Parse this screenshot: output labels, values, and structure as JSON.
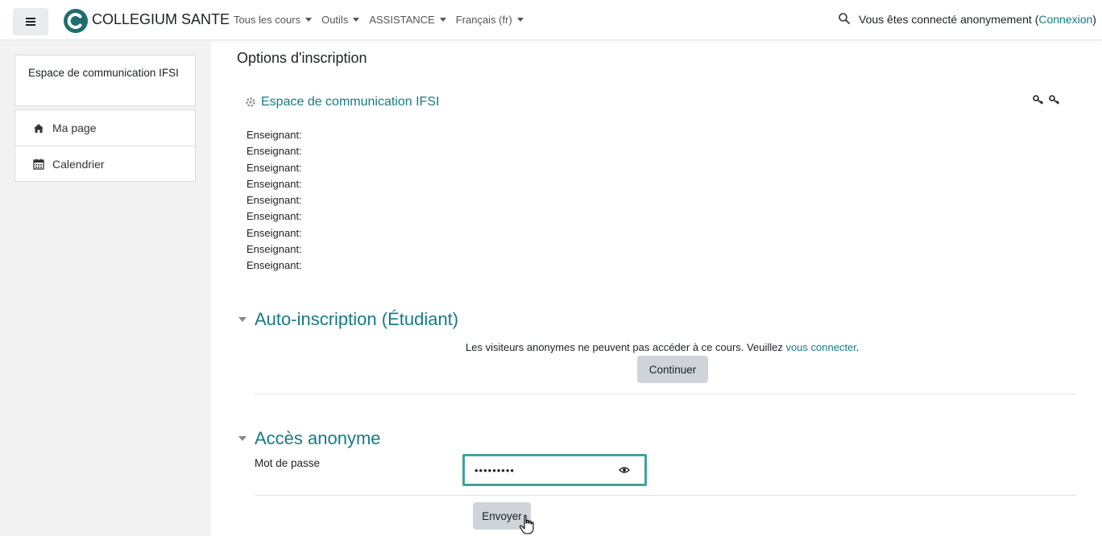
{
  "navbar": {
    "brand": "COLLEGIUM SANTE",
    "menu": [
      {
        "label": "Tous les cours"
      },
      {
        "label": "Outils"
      },
      {
        "label": "ASSISTANCE"
      },
      {
        "label": "Français (fr)"
      }
    ],
    "login_text": "Vous êtes connecté anonymement (",
    "login_link": "Connexion",
    "login_close": ")"
  },
  "drawer": {
    "course_title": "Espace de communication IFSI",
    "items": [
      {
        "label": "Ma page",
        "icon": "home-icon"
      },
      {
        "label": "Calendrier",
        "icon": "calendar-icon"
      }
    ]
  },
  "main": {
    "page_title": "Options d'inscription",
    "course_link": "Espace de communication IFSI",
    "teachers": [
      "Enseignant:",
      "Enseignant:",
      "Enseignant:",
      "Enseignant:",
      "Enseignant:",
      "Enseignant:",
      "Enseignant:",
      "Enseignant:",
      "Enseignant:"
    ],
    "self_enrol": {
      "heading": "Auto-inscription (Étudiant)",
      "notice_text": "Les visiteurs anonymes ne peuvent pas accéder à ce cours. Veuillez ",
      "notice_link": "vous connecter",
      "notice_end": ".",
      "continue_label": "Continuer"
    },
    "guest": {
      "heading": "Accès anonyme",
      "password_label": "Mot de passe",
      "password_value": "•••••••••",
      "submit_label": "Envoyer"
    }
  },
  "colors": {
    "accent": "#167c80",
    "focus_border": "#43a19c",
    "button_bg": "#ced4da"
  }
}
